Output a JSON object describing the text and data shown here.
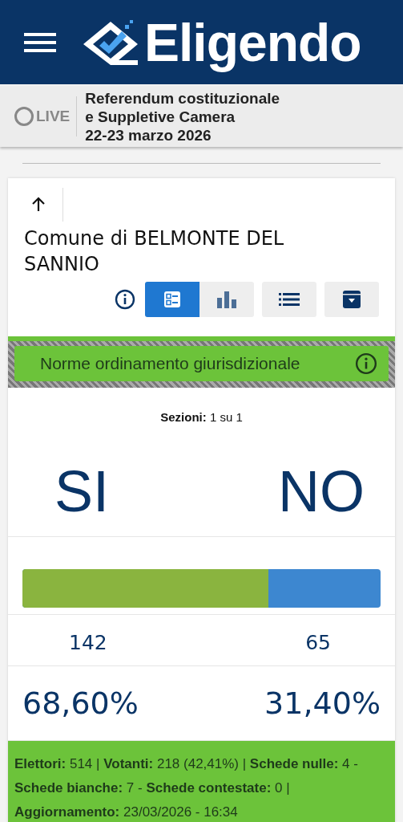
{
  "header": {
    "brand": "Eligendo"
  },
  "live": {
    "label": "LIVE",
    "on": false,
    "title": "Referendum costituzionale\ne Suppletive Camera\n22-23 marzo 2026"
  },
  "card": {
    "title": "Comune di BELMONTE DEL SANNIO",
    "view_buttons": [
      {
        "kind": "cards",
        "selected": true
      },
      {
        "kind": "chart",
        "selected": false
      }
    ],
    "tools": [
      {
        "kind": "list"
      },
      {
        "kind": "archive"
      }
    ],
    "banner": "Norme ordinamento giurisdizionale",
    "sections_label": "Sezioni:",
    "sections_value": "1 su 1",
    "options": [
      {
        "label": "SI",
        "votes": "142",
        "percent": "68,60%",
        "level": 0.686,
        "color": "#8ab43f"
      },
      {
        "label": "NO",
        "votes": "65",
        "percent": "31,40%",
        "color": "#3d87d0"
      }
    ],
    "footer": "**Elettori:** 514 | **Votanti:** 218 (42,41%) | **Schede nulle:** 4 - **Schede bianche:** 7 - **Schede contestate:** 0 | **Aggiornamento:** 23/03/2026 - 16:34"
  }
}
